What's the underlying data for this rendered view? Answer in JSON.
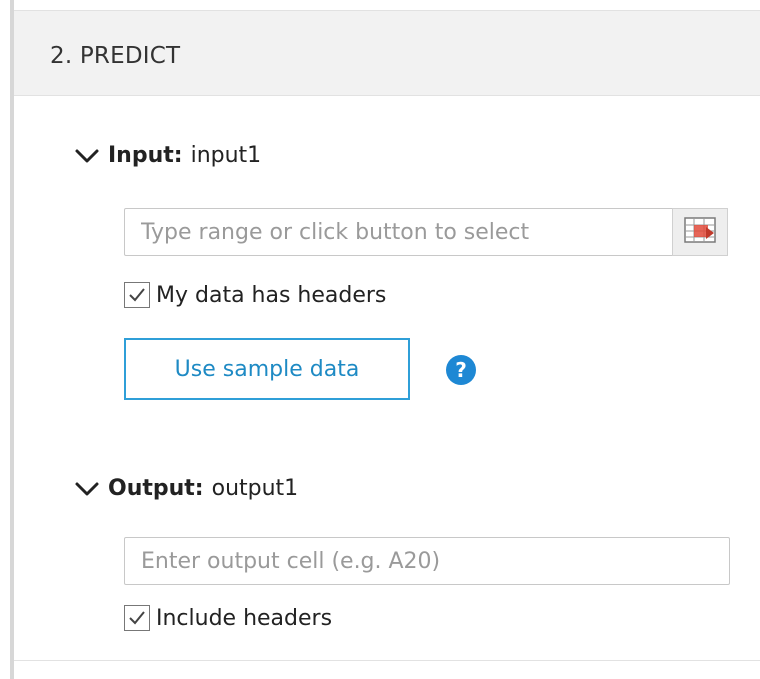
{
  "section": {
    "title": "2. PREDICT"
  },
  "input_group": {
    "label": "Input:",
    "name": "input1",
    "range_placeholder": "Type range or click button to select",
    "range_value": "",
    "range_button_icon": "select-range-icon",
    "headers_checkbox_label": "My data has headers",
    "headers_checked": true,
    "sample_button_label": "Use sample data",
    "help_icon_glyph": "?"
  },
  "output_group": {
    "label": "Output:",
    "name": "output1",
    "cell_placeholder": "Enter output cell (e.g. A20)",
    "cell_value": "",
    "headers_checkbox_label": "Include headers",
    "headers_checked": true
  },
  "colors": {
    "accent": "#2f9fd8",
    "help_icon": "#1e88d4",
    "header_background": "#f2f2f2"
  }
}
